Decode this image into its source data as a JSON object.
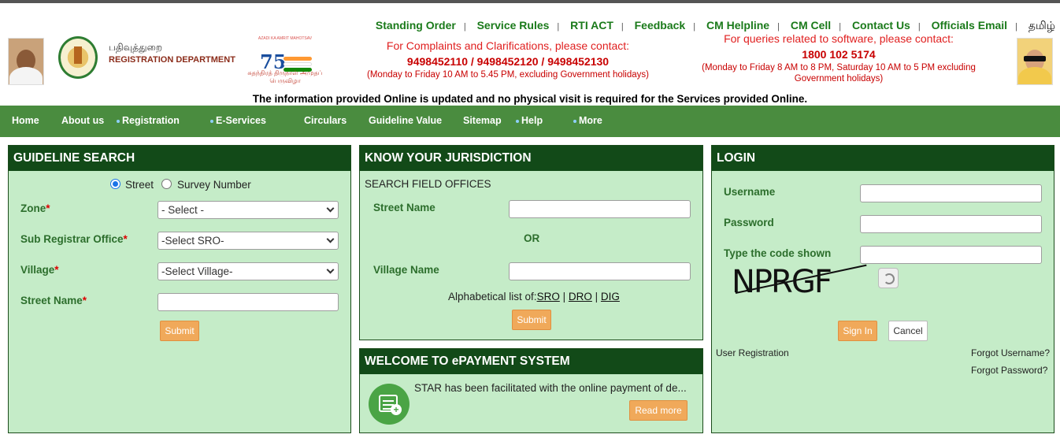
{
  "header": {
    "dept_tamil": "பதிவுத்துறை",
    "dept_english": "REGISTRATION DEPARTMENT",
    "azadi_small": "AZADI KA AMRIT MAHOTSAV",
    "azadi_number": "75",
    "azadi_tamil": "சுதந்திரத் திருநாள் அமுதப் பெருவிழா",
    "links": [
      "Standing Order",
      "Service Rules",
      "RTI ACT",
      "Feedback",
      "CM Helpline",
      "CM Cell",
      "Contact Us",
      "Officials Email",
      "தமிழ்"
    ],
    "complaints_title": "For Complaints and Clarifications, please contact:",
    "complaints_numbers": "9498452110 / 9498452120 / 9498452130",
    "complaints_hours": "(Monday to Friday 10 AM to 5.45 PM, excluding Government holidays)",
    "software_title": "For queries related to software, please contact:",
    "software_number": "1800 102 5174",
    "software_hours_1": "(Monday to Friday 8 AM to 8 PM, Saturday 10 AM to 5 PM excluding",
    "software_hours_2": "Government holidays)",
    "notice": "The information provided Online is updated and no physical visit is required for the Services provided Online."
  },
  "nav": {
    "items": [
      "Home",
      "About us",
      "Registration",
      "E-Services",
      "Circulars",
      "Guideline Value",
      "Sitemap",
      "Help",
      "More"
    ]
  },
  "guideline": {
    "title": "GUIDELINE SEARCH",
    "radio_street": "Street",
    "radio_survey": "Survey Number",
    "zone_label": "Zone",
    "zone_value": "- Select -",
    "sro_label": "Sub Registrar Office",
    "sro_value": "-Select SRO-",
    "village_label": "Village",
    "village_value": "-Select Village-",
    "street_label": "Street Name",
    "required_mark": "*",
    "submit": "Submit"
  },
  "jurisdiction": {
    "title": "KNOW YOUR JURISDICTION",
    "subtitle": "SEARCH FIELD OFFICES",
    "street_label": "Street Name",
    "or": "OR",
    "village_label": "Village Name",
    "alpha_prefix": "Alphabetical list of:",
    "link_sro": "SRO",
    "link_dro": "DRO",
    "link_dig": "DIG",
    "sep": "|",
    "submit": "Submit"
  },
  "epayment": {
    "title": "WELCOME TO ePAYMENT SYSTEM",
    "text": "STAR has been facilitated with the online payment of de...",
    "read_more": "Read more"
  },
  "login": {
    "title": "LOGIN",
    "username_label": "Username",
    "password_label": "Password",
    "code_label": "Type the code shown",
    "captcha": "NPRGF",
    "sign_in": "Sign In",
    "cancel": "Cancel",
    "user_registration": "User Registration",
    "forgot_username": "Forgot Username?",
    "forgot_password": "Forgot Password?"
  },
  "colors": {
    "nav_bg": "#4a8c3f",
    "panel_header": "#124a18",
    "panel_bg": "#c5ecc8",
    "button": "#f0a95a",
    "link_green": "#1a7a1a",
    "alert_red": "#c80000"
  }
}
